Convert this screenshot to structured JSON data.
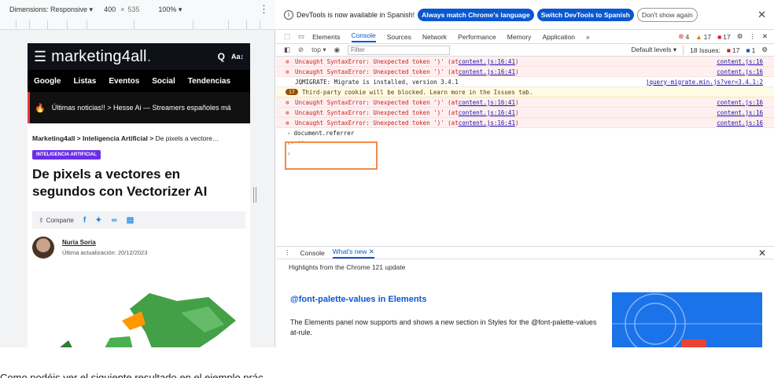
{
  "device_toolbar": {
    "dimension_label": "Dimensions: Responsive ▾",
    "width": "400",
    "times": "×",
    "height": "535",
    "zoom": "100% ▾",
    "menu": "⋮"
  },
  "site": {
    "logo_text": "marketing4all",
    "logo_dot": ".",
    "aa_label": "Aa↕",
    "nav": [
      "Google",
      "Listas",
      "Eventos",
      "Social",
      "Tendencias"
    ],
    "news_ticker": "Últimas noticias!!  >  Hesse Ai  —  Streamers españoles má",
    "breadcrumb_bold": "Marketing4all > Inteligencia Artificial >",
    "breadcrumb_rest": " De pixels a vectore…",
    "category": "INTELIGENCIA ARTIFICIAL",
    "title": "De pixels a vectores en segundos con Vectorizer AI",
    "share_label": "Comparte",
    "author_name": "Nuria Soria",
    "updated": "Última actualización: 20/12/2023"
  },
  "devtools": {
    "info_text": "DevTools is now available in Spanish!",
    "btn_match": "Always match Chrome's language",
    "btn_switch": "Switch DevTools to Spanish",
    "btn_dont_show": "Don't show again",
    "tabs": [
      "Elements",
      "Console",
      "Sources",
      "Network",
      "Performance",
      "Memory",
      "Application",
      "»"
    ],
    "active_tab": "Console",
    "err_count": "4",
    "warn_count": "17",
    "info_count": "17",
    "context": "top ▾",
    "filter_placeholder": "Filter",
    "levels": "Default levels ▾",
    "issues": "18 Issues:",
    "issues_a": "17",
    "issues_b": "1",
    "messages": [
      {
        "type": "err",
        "text": "Uncaught SyntaxError: Unexpected token ')' (at ",
        "link": "content.js:16:41",
        "tail": ")",
        "src": "content.js:16"
      },
      {
        "type": "err",
        "text": "Uncaught SyntaxError: Unexpected token ')' (at ",
        "link": "content.js:16:41",
        "tail": ")",
        "src": "content.js:16"
      },
      {
        "type": "info",
        "text": "JQMIGRATE: Migrate is installed, version 3.4.1",
        "link": "",
        "tail": "",
        "src": "jquery-migrate.min.js?ver=3.4.1:2"
      },
      {
        "type": "warn",
        "badge": "17",
        "text": "Third-party cookie will be blocked. Learn more in the Issues tab.",
        "link": "",
        "tail": "",
        "src": ""
      },
      {
        "type": "err",
        "text": "Uncaught SyntaxError: Unexpected token ')' (at ",
        "link": "content.js:16:41",
        "tail": ")",
        "src": "content.js:16"
      },
      {
        "type": "err",
        "text": "Uncaught SyntaxError: Unexpected token ')' (at ",
        "link": "content.js:16:41",
        "tail": ")",
        "src": "content.js:16"
      },
      {
        "type": "err",
        "text": "Uncaught SyntaxError: Unexpected token ')' (at ",
        "link": "content.js:16:41",
        "tail": ")",
        "src": "content.js:16"
      }
    ],
    "prompt_input": "document.referrer",
    "prompt_result": "''",
    "drawer_tabs": [
      "Console",
      "What's new"
    ],
    "drawer_active": "What's new",
    "highlights": "Highlights from the Chrome 121 update",
    "wn_title": "@font-palette-values in Elements",
    "wn_desc": "The Elements panel now supports and shows a new section in Styles for the @font-palette-values at-rule."
  },
  "caption": "Como podéis ver el siguiente resultado en el ejemplo prác…"
}
